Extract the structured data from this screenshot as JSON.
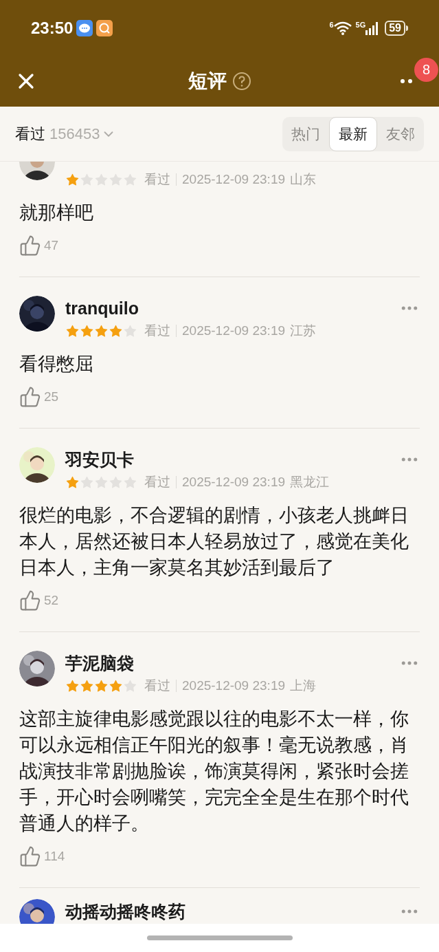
{
  "status_bar": {
    "time": "23:50",
    "wifi_label": "6",
    "network": "5G",
    "battery": "59"
  },
  "nav": {
    "title": "短评",
    "badge": "8"
  },
  "filter": {
    "label": "看过",
    "count": "156453",
    "tabs": [
      {
        "label": "热门",
        "selected": false
      },
      {
        "label": "最新",
        "selected": true
      },
      {
        "label": "友邻",
        "selected": false
      }
    ]
  },
  "reviews": [
    {
      "stars": 1,
      "watched": "看过",
      "time": "2025-12-09 23:19",
      "location": "山东",
      "text": "就那样吧",
      "likes": "47"
    },
    {
      "name": "tranquilo",
      "stars": 4,
      "watched": "看过",
      "time": "2025-12-09 23:19",
      "location": "江苏",
      "text": "看得憋屈",
      "likes": "25"
    },
    {
      "name": "羽安贝卡",
      "stars": 1,
      "watched": "看过",
      "time": "2025-12-09 23:19",
      "location": "黑龙江",
      "text": "很烂的电影，不合逻辑的剧情，小孩老人挑衅日本人，居然还被日本人轻易放过了，感觉在美化日本人，主角一家莫名其妙活到最后了",
      "likes": "52"
    },
    {
      "name": "芋泥脑袋",
      "stars": 4,
      "watched": "看过",
      "time": "2025-12-09 23:19",
      "location": "上海",
      "text": "这部主旋律电影感觉跟以往的电影不太一样，你可以永远相信正午阳光的叙事！毫无说教感，肖战演技非常剧抛脸诶，饰演莫得闲，紧张时会搓手，开心时会咧嘴笑，完完全全是生在那个时代普通人的样子。",
      "likes": "114"
    },
    {
      "name": "动摇动摇咚咚药"
    }
  ]
}
